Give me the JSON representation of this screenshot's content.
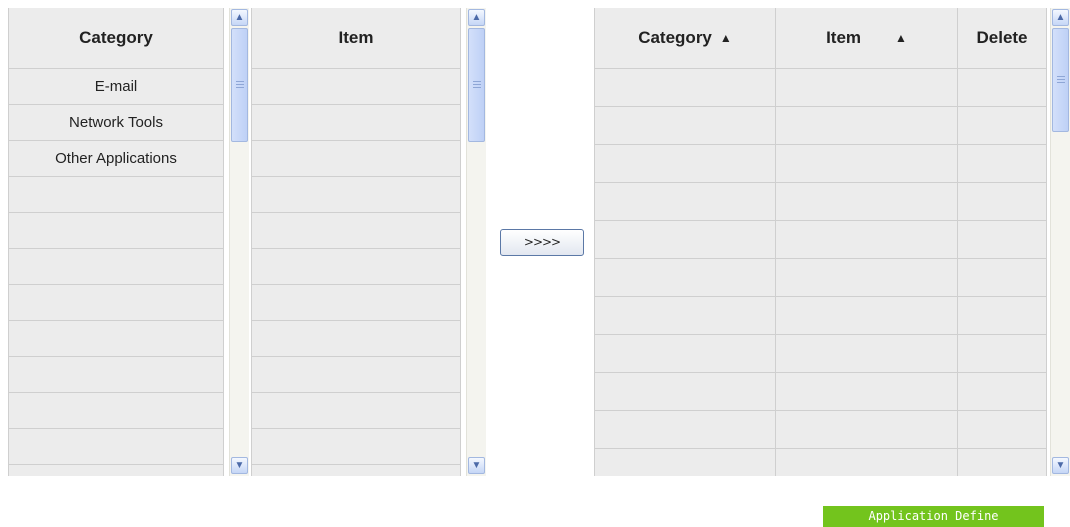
{
  "category_panel": {
    "header": "Category",
    "rows": [
      "E-mail",
      "Network Tools",
      "Other Applications",
      "",
      "",
      "",
      "",
      "",
      "",
      "",
      "",
      ""
    ]
  },
  "item_panel": {
    "header": "Item",
    "rows": [
      "",
      "",
      "",
      "",
      "",
      "",
      "",
      "",
      "",
      "",
      "",
      ""
    ]
  },
  "move_button": {
    "label": ">>>>"
  },
  "selected_panel": {
    "headers": {
      "category": "Category",
      "item": "Item",
      "delete": "Delete",
      "sort_arrow": "▲"
    },
    "row_count": 11
  },
  "scroll_icons": {
    "up": "▲",
    "down": "▼"
  },
  "footer": {
    "label": "Application Define"
  },
  "colors": {
    "accent_green": "#73c41d",
    "cell_bg": "#ececec",
    "grid_line": "#cfcfcf"
  }
}
